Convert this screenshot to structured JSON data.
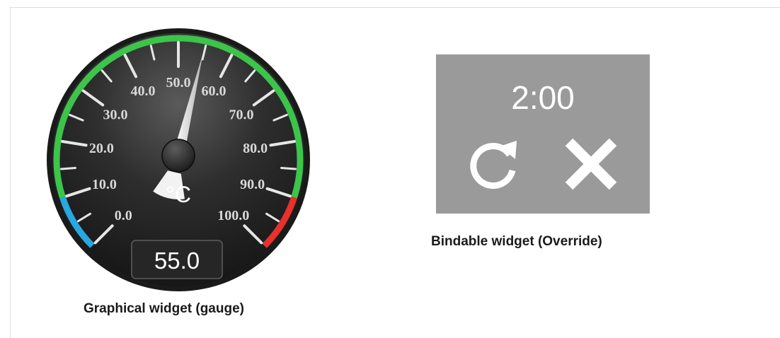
{
  "gauge": {
    "tick_labels": [
      "0.0",
      "10.0",
      "20.0",
      "30.0",
      "40.0",
      "50.0",
      "60.0",
      "70.0",
      "80.0",
      "90.0",
      "100.0"
    ],
    "unit": "°C",
    "value": 55.0,
    "value_display": "55.0",
    "range": [
      0,
      100
    ],
    "zones": [
      {
        "from": 0,
        "to": 10,
        "color": "#29a7e1"
      },
      {
        "from": 10,
        "to": 90,
        "color": "#3cc44b"
      },
      {
        "from": 90,
        "to": 100,
        "color": "#e8312c"
      }
    ],
    "caption": "Graphical widget (gauge)"
  },
  "override": {
    "time": "2:00",
    "refresh_icon": "refresh-icon",
    "cancel_icon": "close-icon",
    "background": "#9a9a9a",
    "caption": "Bindable widget (Override)"
  }
}
